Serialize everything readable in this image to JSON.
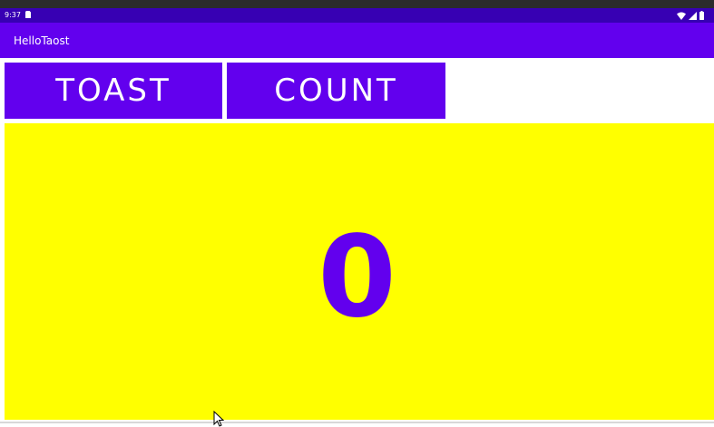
{
  "statusbar": {
    "time": "9:37",
    "icons": [
      "sim-card-icon",
      "wifi-icon",
      "signal-icon",
      "battery-icon"
    ]
  },
  "appbar": {
    "title": "HelloTaost"
  },
  "buttons": {
    "toast_label": "TOAST",
    "count_label": "COUNT"
  },
  "counter": {
    "value": "0"
  },
  "colors": {
    "status_bar": "#3700b3",
    "primary": "#6200ee",
    "count_background": "#ffff00",
    "button_text": "#ffffff"
  }
}
